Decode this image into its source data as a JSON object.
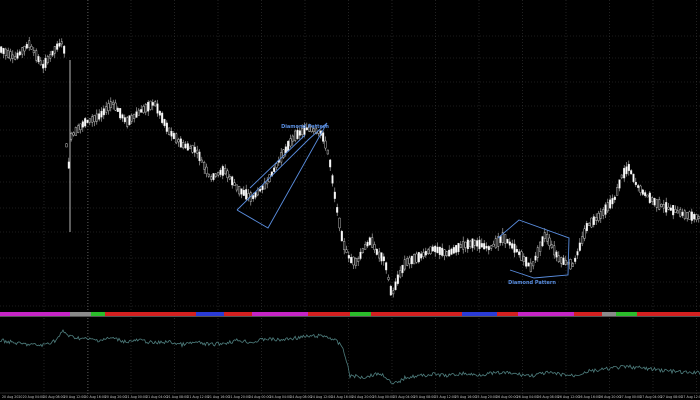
{
  "colors": {
    "background": "#000000",
    "candle_up": "#ffffff",
    "candle_down": "#000000",
    "candle_outline": "#e6e6e6",
    "grid": "#3a3a3a",
    "annotation": "#5a8ee0",
    "indicator_line": "#4f7f7f",
    "separator": "#6f6f6f",
    "period_green": "#2bbd2b",
    "period_red": "#d42020",
    "period_magenta": "#c624c6",
    "period_blue": "#2a3bd6",
    "period_gray": "#8a8a8a"
  },
  "annotations": {
    "top_label": "Diamond Pattern",
    "bottom_label": "Diamond Pattern"
  },
  "time_labels": [
    "20 Aug 2020",
    "20 Aug 04:00",
    "20 Aug 08:00",
    "20 Aug 12:00",
    "20 Aug 16:00",
    "20 Aug 20:00",
    "21 Aug 00:00",
    "21 Aug 04:00",
    "21 Aug 08:00",
    "21 Aug 12:00",
    "21 Aug 16:00",
    "21 Aug 20:00",
    "24 Aug 00:00",
    "24 Aug 04:00",
    "24 Aug 08:00",
    "24 Aug 12:00",
    "24 Aug 16:00",
    "24 Aug 20:00",
    "25 Aug 00:00",
    "25 Aug 04:00",
    "25 Aug 08:00",
    "25 Aug 12:00",
    "25 Aug 16:00",
    "25 Aug 20:00",
    "26 Aug 00:00",
    "26 Aug 04:00",
    "26 Aug 08:00",
    "26 Aug 12:00",
    "26 Aug 16:00",
    "26 Aug 20:00",
    "27 Aug 00:00",
    "27 Aug 04:00",
    "27 Aug 08:00",
    "27 Aug 12:00"
  ],
  "period_bar_segments": [
    {
      "color": "magenta",
      "from": 0,
      "to": 0.1
    },
    {
      "color": "gray",
      "from": 0.1,
      "to": 0.13
    },
    {
      "color": "green",
      "from": 0.13,
      "to": 0.15
    },
    {
      "color": "red",
      "from": 0.15,
      "to": 0.28
    },
    {
      "color": "blue",
      "from": 0.28,
      "to": 0.32
    },
    {
      "color": "red",
      "from": 0.32,
      "to": 0.36
    },
    {
      "color": "magenta",
      "from": 0.36,
      "to": 0.44
    },
    {
      "color": "red",
      "from": 0.44,
      "to": 0.5
    },
    {
      "color": "green",
      "from": 0.5,
      "to": 0.53
    },
    {
      "color": "red",
      "from": 0.53,
      "to": 0.66
    },
    {
      "color": "blue",
      "from": 0.66,
      "to": 0.71
    },
    {
      "color": "red",
      "from": 0.71,
      "to": 0.74
    },
    {
      "color": "magenta",
      "from": 0.74,
      "to": 0.82
    },
    {
      "color": "red",
      "from": 0.82,
      "to": 0.86
    },
    {
      "color": "gray",
      "from": 0.86,
      "to": 0.88
    },
    {
      "color": "green",
      "from": 0.88,
      "to": 0.91
    },
    {
      "color": "red",
      "from": 0.91,
      "to": 1.0
    }
  ],
  "price_path": [
    [
      0,
      0.07
    ],
    [
      0.02,
      0.1
    ],
    [
      0.04,
      0.05
    ],
    [
      0.06,
      0.13
    ],
    [
      0.08,
      0.06
    ],
    [
      0.09,
      0.04
    ],
    [
      0.095,
      0.55
    ],
    [
      0.1,
      0.38
    ],
    [
      0.12,
      0.33
    ],
    [
      0.14,
      0.31
    ],
    [
      0.16,
      0.26
    ],
    [
      0.18,
      0.33
    ],
    [
      0.2,
      0.29
    ],
    [
      0.22,
      0.26
    ],
    [
      0.24,
      0.36
    ],
    [
      0.26,
      0.41
    ],
    [
      0.28,
      0.43
    ],
    [
      0.3,
      0.53
    ],
    [
      0.32,
      0.5
    ],
    [
      0.34,
      0.57
    ],
    [
      0.36,
      0.6
    ],
    [
      0.38,
      0.55
    ],
    [
      0.4,
      0.46
    ],
    [
      0.42,
      0.38
    ],
    [
      0.44,
      0.35
    ],
    [
      0.46,
      0.37
    ],
    [
      0.47,
      0.45
    ],
    [
      0.48,
      0.62
    ],
    [
      0.49,
      0.76
    ],
    [
      0.5,
      0.82
    ],
    [
      0.51,
      0.83
    ],
    [
      0.52,
      0.78
    ],
    [
      0.53,
      0.75
    ],
    [
      0.54,
      0.8
    ],
    [
      0.55,
      0.82
    ],
    [
      0.56,
      0.95
    ],
    [
      0.57,
      0.88
    ],
    [
      0.58,
      0.83
    ],
    [
      0.6,
      0.81
    ],
    [
      0.62,
      0.78
    ],
    [
      0.64,
      0.8
    ],
    [
      0.66,
      0.77
    ],
    [
      0.68,
      0.76
    ],
    [
      0.7,
      0.78
    ],
    [
      0.72,
      0.74
    ],
    [
      0.74,
      0.79
    ],
    [
      0.76,
      0.85
    ],
    [
      0.78,
      0.73
    ],
    [
      0.8,
      0.82
    ],
    [
      0.82,
      0.84
    ],
    [
      0.84,
      0.7
    ],
    [
      0.86,
      0.66
    ],
    [
      0.88,
      0.6
    ],
    [
      0.89,
      0.52
    ],
    [
      0.9,
      0.49
    ],
    [
      0.91,
      0.55
    ],
    [
      0.92,
      0.58
    ],
    [
      0.94,
      0.62
    ],
    [
      0.96,
      0.64
    ],
    [
      0.98,
      0.66
    ],
    [
      1.0,
      0.67
    ]
  ],
  "indicator_path": [
    [
      0,
      0.3
    ],
    [
      0.03,
      0.35
    ],
    [
      0.06,
      0.37
    ],
    [
      0.08,
      0.3
    ],
    [
      0.09,
      0.18
    ],
    [
      0.1,
      0.25
    ],
    [
      0.12,
      0.28
    ],
    [
      0.14,
      0.3
    ],
    [
      0.16,
      0.27
    ],
    [
      0.18,
      0.32
    ],
    [
      0.2,
      0.3
    ],
    [
      0.22,
      0.34
    ],
    [
      0.24,
      0.32
    ],
    [
      0.26,
      0.36
    ],
    [
      0.28,
      0.33
    ],
    [
      0.3,
      0.36
    ],
    [
      0.32,
      0.34
    ],
    [
      0.34,
      0.3
    ],
    [
      0.36,
      0.33
    ],
    [
      0.38,
      0.28
    ],
    [
      0.4,
      0.3
    ],
    [
      0.42,
      0.27
    ],
    [
      0.44,
      0.25
    ],
    [
      0.46,
      0.24
    ],
    [
      0.47,
      0.26
    ],
    [
      0.48,
      0.31
    ],
    [
      0.49,
      0.4
    ],
    [
      0.5,
      0.78
    ],
    [
      0.52,
      0.8
    ],
    [
      0.54,
      0.75
    ],
    [
      0.55,
      0.78
    ],
    [
      0.56,
      0.9
    ],
    [
      0.57,
      0.86
    ],
    [
      0.58,
      0.8
    ],
    [
      0.6,
      0.78
    ],
    [
      0.62,
      0.76
    ],
    [
      0.64,
      0.78
    ],
    [
      0.66,
      0.75
    ],
    [
      0.68,
      0.77
    ],
    [
      0.7,
      0.75
    ],
    [
      0.72,
      0.74
    ],
    [
      0.74,
      0.76
    ],
    [
      0.76,
      0.78
    ],
    [
      0.78,
      0.74
    ],
    [
      0.8,
      0.76
    ],
    [
      0.82,
      0.78
    ],
    [
      0.84,
      0.72
    ],
    [
      0.86,
      0.7
    ],
    [
      0.88,
      0.67
    ],
    [
      0.9,
      0.66
    ],
    [
      0.92,
      0.68
    ],
    [
      0.94,
      0.7
    ],
    [
      0.96,
      0.72
    ],
    [
      0.98,
      0.74
    ],
    [
      1.0,
      0.74
    ]
  ]
}
